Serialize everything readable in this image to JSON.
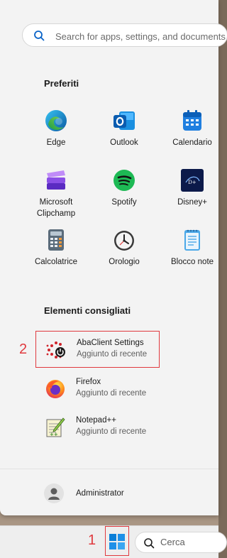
{
  "search": {
    "placeholder": "Search for apps, settings, and documents"
  },
  "pinned": {
    "title": "Preferiti",
    "apps": [
      {
        "label": "Edge",
        "icon": "edge-icon"
      },
      {
        "label": "Outlook",
        "icon": "outlook-icon"
      },
      {
        "label": "Calendario",
        "icon": "calendar-icon"
      },
      {
        "label": "Microsoft\nClipchamp",
        "icon": "clipchamp-icon"
      },
      {
        "label": "Spotify",
        "icon": "spotify-icon"
      },
      {
        "label": "Disney+",
        "icon": "disney-plus-icon"
      },
      {
        "label": "Calcolatrice",
        "icon": "calculator-icon"
      },
      {
        "label": "Orologio",
        "icon": "clock-icon"
      },
      {
        "label": "Blocco note",
        "icon": "notepad-icon"
      }
    ]
  },
  "recommended": {
    "title": "Elementi consigliati",
    "items": [
      {
        "name": "AbaClient Settings",
        "sub": "Aggiunto di recente",
        "icon": "abaclient-icon"
      },
      {
        "name": "Firefox",
        "sub": "Aggiunto di recente",
        "icon": "firefox-icon"
      },
      {
        "name": "Notepad++",
        "sub": "Aggiunto di recente",
        "icon": "notepadpp-icon"
      }
    ]
  },
  "user": {
    "name": "Administrator"
  },
  "taskbar": {
    "search_label": "Cerca"
  },
  "annotations": {
    "marker_1": "1",
    "marker_2": "2"
  },
  "colors": {
    "accent": "#0078d4",
    "marker": "#e0393e"
  }
}
